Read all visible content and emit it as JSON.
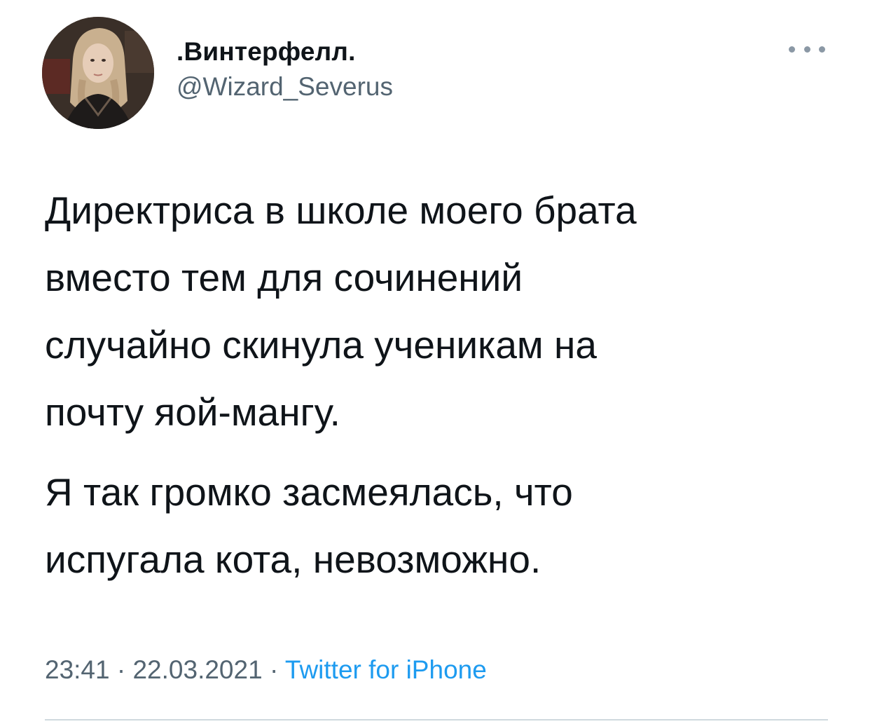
{
  "tweet": {
    "author": {
      "display_name": ".Винтерфелл.",
      "handle": "@Wizard_Severus"
    },
    "more_icon": "more-horizontal-icon",
    "paragraphs": [
      "Директриса в школе моего брата\nвместо тем для сочинений\nслучайно скинула ученикам на\nпочту яой-мангу.",
      "Я так громко засмеялась, что\nиспугала кота, невозможно."
    ],
    "time": "23:41",
    "separator": " · ",
    "date": "22.03.2021",
    "source": "Twitter for iPhone"
  },
  "colors": {
    "text": "#0f1419",
    "secondary": "#536471",
    "link": "#1d9bf0",
    "divider": "#cfd9de"
  }
}
